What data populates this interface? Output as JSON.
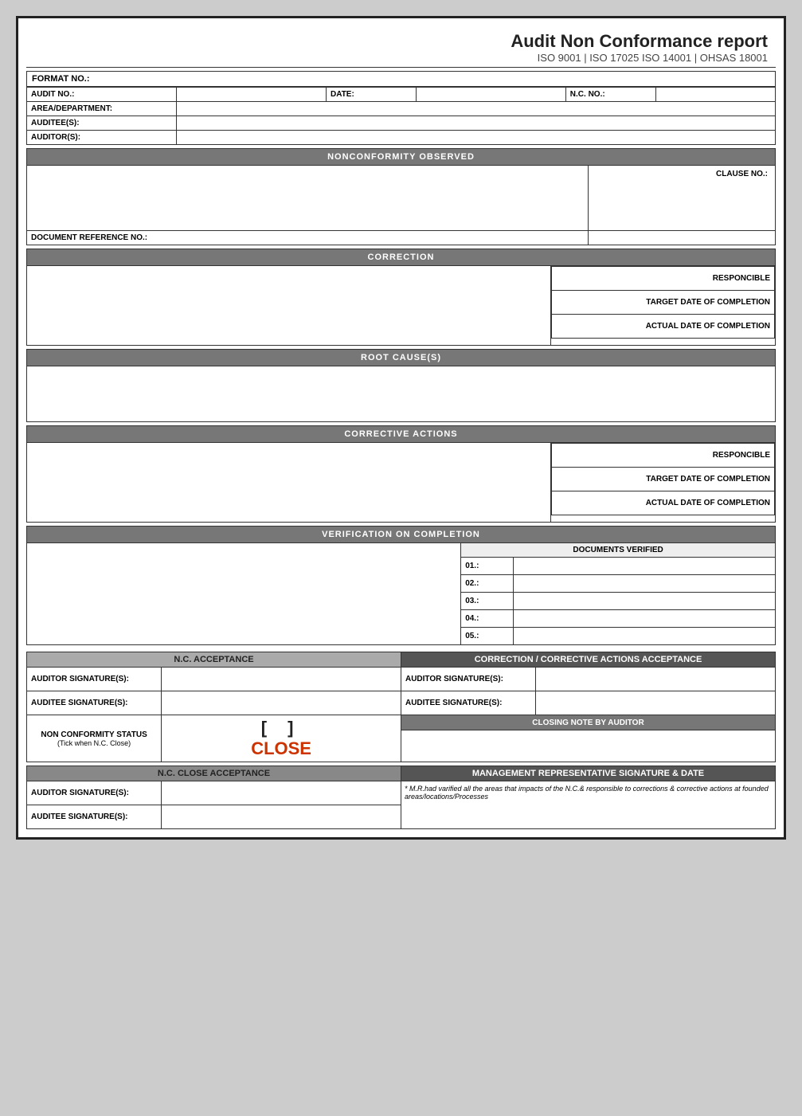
{
  "header": {
    "title": "Audit Non Conformance report",
    "subtitle": "ISO 9001 | ISO 17025 ISO 14001 | OHSAS 18001"
  },
  "format_no_label": "FORMAT NO.:",
  "fields": {
    "audit_no_label": "AUDIT NO.:",
    "date_label": "DATE:",
    "nc_no_label": "N.C. NO.:",
    "area_label": "AREA/DEPARTMENT:",
    "auditee_label": "AUDITEE(S):",
    "auditor_label": "AUDITOR(S):"
  },
  "sections": {
    "nonconformity": "NONCONFORMITY OBSERVED",
    "clause_no": "CLAUSE NO.:",
    "doc_ref": "DOCUMENT REFERENCE NO.:",
    "correction": "CORRECTION",
    "responsible_1": "RESPONCIBLE",
    "target_date_1": "TARGET DATE OF COMPLETION",
    "actual_date_1": "ACTUAL DATE OF COMPLETION",
    "root_cause": "ROOT CAUSE(S)",
    "corrective_actions": "CORRECTIVE ACTIONS",
    "responsible_2": "RESPONCIBLE",
    "target_date_2": "TARGET DATE OF COMPLETION",
    "actual_date_2": "ACTUAL DATE OF COMPLETION",
    "verification": "VERIFICATION ON COMPLETION",
    "docs_verified": "DOCUMENTS VERIFIED",
    "doc_rows": [
      "01.:",
      "02.:",
      "03.:",
      "04.:",
      "05.:"
    ]
  },
  "acceptance": {
    "nc_acceptance": "N.C. ACCEPTANCE",
    "correction_acceptance": "CORRECTION / CORRECTIVE ACTIONS ACCEPTANCE",
    "auditor_sig_1": "AUDITOR SIGNATURE(S):",
    "auditee_sig_1": "AUDITEE SIGNATURE(S):",
    "auditor_sig_2": "AUDITOR SIGNATURE(S):",
    "auditee_sig_2": "AUDITEE SIGNATURE(S):",
    "nc_status_label": "NON CONFORMITY STATUS",
    "nc_status_sub": "(Tick when N.C. Close)",
    "close_bracket": "[          ]",
    "close_text": "CLOSE",
    "closing_note": "CLOSING NOTE BY AUDITOR",
    "nc_close_acceptance": "N.C. CLOSE ACCEPTANCE",
    "mgmt_rep": "MANAGEMENT REPRESENTATIVE SIGNATURE & DATE",
    "auditor_sig_3": "AUDITOR SIGNATURE(S):",
    "auditee_sig_3": "AUDITEE SIGNATURE(S):",
    "mr_note": "* M.R.had varified all the areas that impacts of the N.C.& responsible to corrections & corrective actions at founded areas/locations/Processes"
  }
}
